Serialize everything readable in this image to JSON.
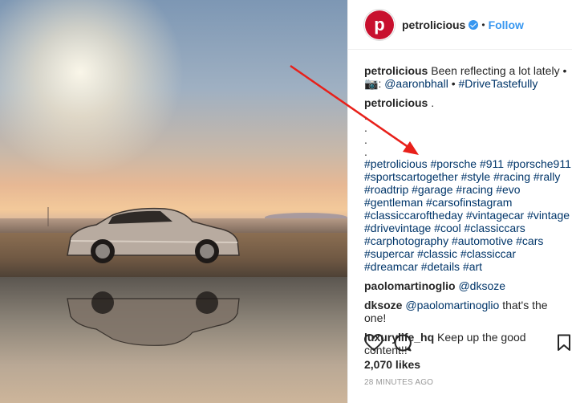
{
  "post": {
    "username": "petrolicious",
    "avatar_letter": "p",
    "follow_label": "Follow",
    "separator": "•"
  },
  "caption": {
    "username": "petrolicious",
    "text": "Been reflecting a lot lately •",
    "camera_glyph": "📷",
    "credit": "@aaronbhall",
    "bullet": "•",
    "tag": "#DriveTastefully",
    "second_username": "petrolicious",
    "second_text": ".",
    "dots": [
      ".",
      ".",
      ".",
      "."
    ],
    "hashtags": "#petrolicious #porsche #911 #porsche911 #sportscartogether #style #racing #rally #roadtrip #garage #racing #evo #gentleman #carsofinstagram #classiccaroftheday #vintagecar #vintage #drivevintage #cool #classiccars #carphotography #automotive #cars #supercar #classic #classiccar #dreamcar #details #art"
  },
  "comments": [
    {
      "user": "paolomartinoglio",
      "mention": "@dksoze",
      "text": ""
    },
    {
      "user": "dksoze",
      "mention": "@paolomartinoglio",
      "text": " that's the one!"
    },
    {
      "user": "luxurylife_hq",
      "mention": "",
      "text": "Keep up the good content!!"
    }
  ],
  "likes": "2,070 likes",
  "timestamp": "28 MINUTES AGO",
  "icons": [
    "heart-icon",
    "comment-icon",
    "bookmark-icon",
    "verified-badge-icon",
    "camera-icon"
  ],
  "colors": {
    "accent": "#3897f0",
    "brand": "#c8102e",
    "annotation": "#e8201a",
    "hashtag": "#003569"
  }
}
